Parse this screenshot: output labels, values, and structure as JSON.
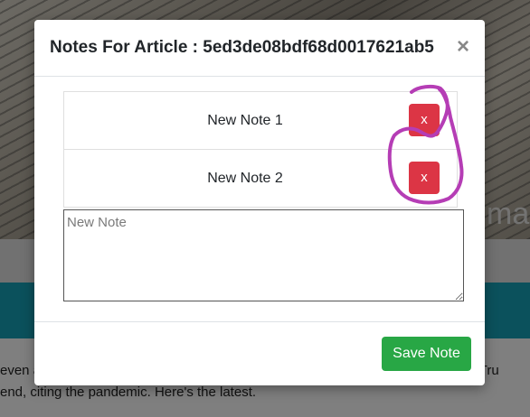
{
  "background": {
    "hero_word": "ma",
    "article_line1_left": "even a",
    "article_line1_right": "ent Tru",
    "article_line2": "end, citing the pandemic. Here's the latest."
  },
  "modal": {
    "title": "Notes For Article : 5ed3de08bdf68d0017621ab5",
    "close_label": "×",
    "notes": [
      {
        "text": "New Note 1",
        "delete_label": "x"
      },
      {
        "text": "New Note 2",
        "delete_label": "x"
      }
    ],
    "textarea_placeholder": "New Note",
    "save_label": "Save Note"
  },
  "colors": {
    "delete": "#dc3545",
    "save": "#28a745",
    "annotation": "#b53db5",
    "teal": "#17a2b8"
  }
}
